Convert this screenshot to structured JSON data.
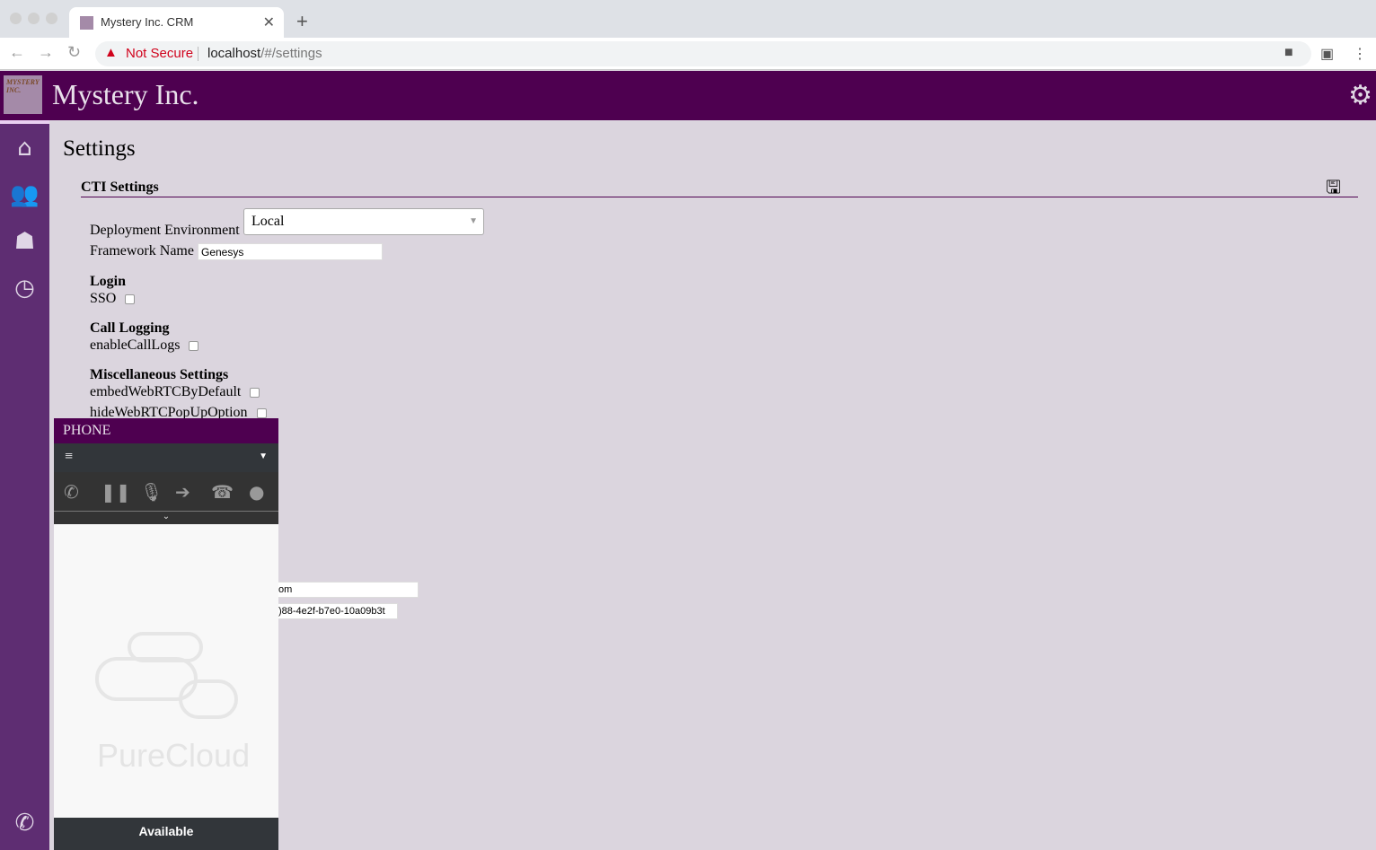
{
  "browser": {
    "tab_title": "Mystery Inc. CRM",
    "security": "Not Secure",
    "url_host": "localhost",
    "url_path": "/#/settings"
  },
  "header": {
    "brand": "Mystery Inc.",
    "logo_text": "MYSTERY INC."
  },
  "sidebar": {
    "items": [
      {
        "icon": "home-icon"
      },
      {
        "icon": "users-icon"
      },
      {
        "icon": "ghost-icon"
      },
      {
        "icon": "clock-icon"
      },
      {
        "icon": "phone-icon"
      }
    ]
  },
  "page": {
    "title": "Settings",
    "section": "CTI Settings",
    "deployment_label": "Deployment Environment",
    "deployment_value": "Local",
    "framework_label": "Framework Name",
    "framework_value": "Genesys",
    "login_heading": "Login",
    "sso_label": "SSO",
    "call_logging_heading": "Call Logging",
    "call_logs_label": "enableCallLogs",
    "misc_heading": "Miscellaneous Settings",
    "embed_label": "embedWebRTCByDefault",
    "hide_label": "hideWebRTCPopUpOption",
    "partial_field_1": "om",
    "partial_field_2": ")88-4e2f-b7e0-10a09b3t"
  },
  "phone": {
    "title": "PHONE",
    "brand": "PureCloud",
    "status": "Available"
  },
  "colors": {
    "header": "#4e0050",
    "sidebar": "#5e2d72",
    "background": "#dbd5de"
  }
}
